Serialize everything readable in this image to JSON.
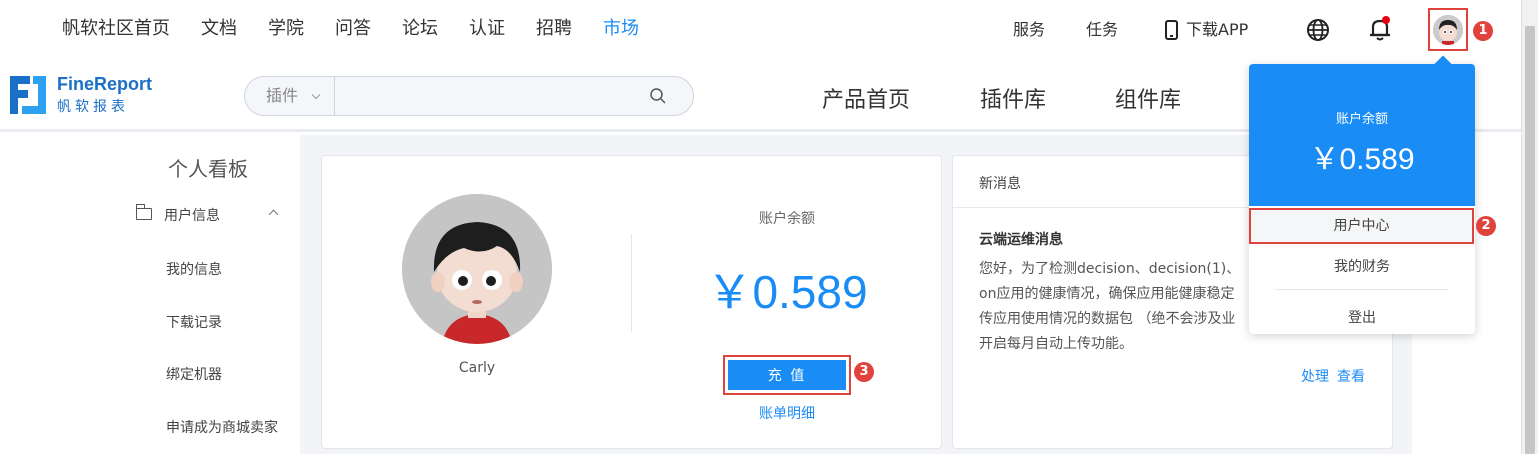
{
  "topnav": {
    "items": [
      "帆软社区首页",
      "文档",
      "学院",
      "问答",
      "论坛",
      "认证",
      "招聘",
      "市场"
    ],
    "active_index": 7,
    "services": "服务",
    "tasks": "任务",
    "download_app": "下载APP"
  },
  "logo": {
    "name_en": "FineReport",
    "name_cn": "帆软报表"
  },
  "search": {
    "category": "插件",
    "value": "",
    "placeholder": ""
  },
  "subnav": {
    "items": [
      "产品首页",
      "插件库",
      "组件库"
    ]
  },
  "sidebar": {
    "title": "个人看板",
    "group_label": "用户信息",
    "items": [
      "我的信息",
      "下载记录",
      "绑定机器",
      "申请成为商城卖家"
    ]
  },
  "profile": {
    "username": "Carly",
    "balance_label": "账户余额",
    "balance_value": "￥0.589",
    "recharge_label": "充 值",
    "bill_link": "账单明细"
  },
  "messages": {
    "header": "新消息",
    "title": "云端运维消息",
    "body_lines": [
      "您好，为了检测decision、decision(1)、",
      "on应用的健康情况，确保应用能健康稳定",
      "传应用使用情况的数据包 （绝不会涉及业",
      "开启每月自动上传功能。"
    ],
    "action_handle": "处理",
    "action_view": "查看"
  },
  "dropdown": {
    "balance_label": "账户余额",
    "balance_value": "￥0.589",
    "user_center": "用户中心",
    "my_finance": "我的财务",
    "logout": "登出"
  },
  "markers": [
    "1",
    "2",
    "3"
  ],
  "colors": {
    "accent": "#1a8cf5",
    "highlight": "#e0433c",
    "notification": "#e0433c"
  }
}
